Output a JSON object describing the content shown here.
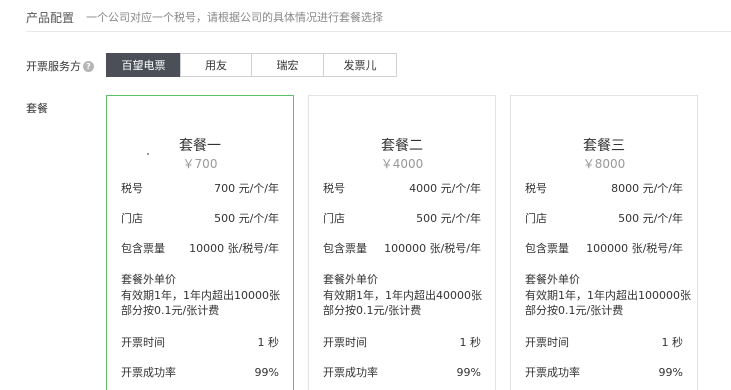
{
  "header": {
    "title": "产品配置",
    "description": "一个公司对应一个税号，请根据公司的具体情况进行套餐选择"
  },
  "provider": {
    "label": "开票服务方",
    "help_icon": "question-circle-icon",
    "tabs": [
      {
        "label": "百望电票",
        "active": true
      },
      {
        "label": "用友",
        "active": false
      },
      {
        "label": "瑞宏",
        "active": false
      },
      {
        "label": "发票儿",
        "active": false
      }
    ]
  },
  "packages": {
    "label": "套餐",
    "selected_index": 0,
    "selected_border_color": "#5cc16a",
    "cards": [
      {
        "name": "套餐一",
        "price": "￥700",
        "rows": [
          {
            "label": "税号",
            "value": "700 元/个/年"
          },
          {
            "label": "门店",
            "value": "500 元/个/年"
          },
          {
            "label": "包含票量",
            "value": "10000 张/税号/年"
          }
        ],
        "extra": [
          "套餐外单价",
          "有效期1年，1年内超出10000张",
          "部分按0.1元/张计费"
        ],
        "time": {
          "label": "开票时间",
          "value": "1 秒"
        },
        "rate": {
          "label": "开票成功率",
          "value": "99%"
        }
      },
      {
        "name": "套餐二",
        "price": "￥4000",
        "rows": [
          {
            "label": "税号",
            "value": "4000 元/个/年"
          },
          {
            "label": "门店",
            "value": "500 元/个/年"
          },
          {
            "label": "包含票量",
            "value": "100000 张/税号/年"
          }
        ],
        "extra": [
          "套餐外单价",
          "有效期1年，1年内超出40000张",
          "部分按0.1元/张计费"
        ],
        "time": {
          "label": "开票时间",
          "value": "1 秒"
        },
        "rate": {
          "label": "开票成功率",
          "value": "99%"
        }
      },
      {
        "name": "套餐三",
        "price": "￥8000",
        "rows": [
          {
            "label": "税号",
            "value": "8000 元/个/年"
          },
          {
            "label": "门店",
            "value": "500 元/个/年"
          },
          {
            "label": "包含票量",
            "value": "100000 张/税号/年"
          }
        ],
        "extra": [
          "套餐外单价",
          "有效期1年，1年内超出100000张",
          "部分按0.1元/张计费"
        ],
        "time": {
          "label": "开票时间",
          "value": "1 秒"
        },
        "rate": {
          "label": "开票成功率",
          "value": "99%"
        }
      }
    ]
  }
}
